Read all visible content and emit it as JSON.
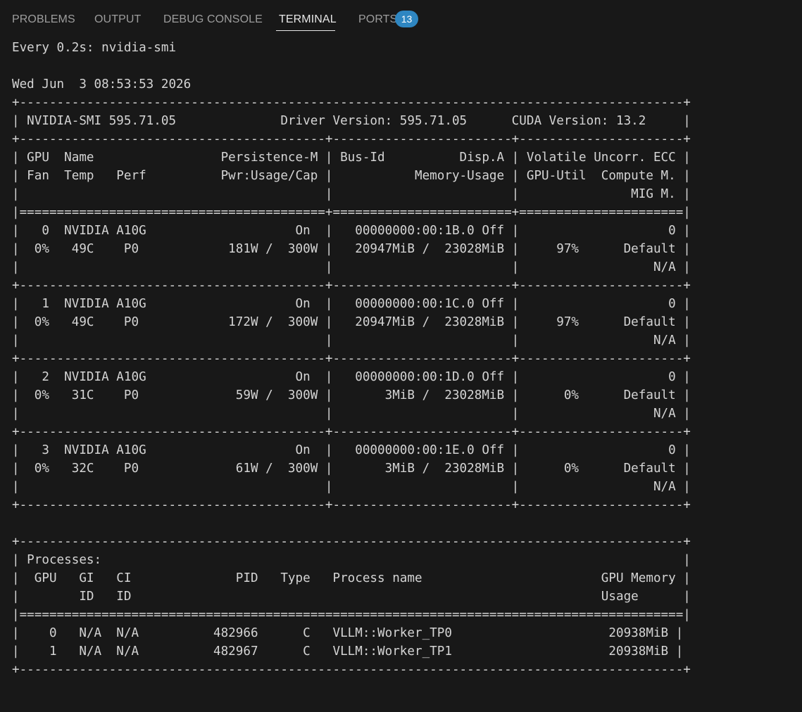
{
  "panel": {
    "tabs": [
      {
        "label": "PROBLEMS"
      },
      {
        "label": "OUTPUT"
      },
      {
        "label": "DEBUG CONSOLE"
      },
      {
        "label": "TERMINAL"
      },
      {
        "label": "PORTS"
      }
    ],
    "active_tab": "TERMINAL",
    "ports_badge": "13"
  },
  "terminal": {
    "lines": [
      "Every 0.2s: nvidia-smi",
      "",
      "Wed Jun  3 08:53:53 2026",
      "+-----------------------------------------------------------------------------------------+",
      "| NVIDIA-SMI 595.71.05              Driver Version: 595.71.05      CUDA Version: 13.2     |",
      "+-----------------------------------------+------------------------+----------------------+",
      "| GPU  Name                 Persistence-M | Bus-Id          Disp.A | Volatile Uncorr. ECC |",
      "| Fan  Temp   Perf          Pwr:Usage/Cap |           Memory-Usage | GPU-Util  Compute M. |",
      "|                                         |                        |               MIG M. |",
      "|=========================================+========================+======================|",
      "|   0  NVIDIA A10G                    On  |   00000000:00:1B.0 Off |                    0 |",
      "|  0%   49C    P0            181W /  300W |   20947MiB /  23028MiB |     97%      Default |",
      "|                                         |                        |                  N/A |",
      "+-----------------------------------------+------------------------+----------------------+",
      "|   1  NVIDIA A10G                    On  |   00000000:00:1C.0 Off |                    0 |",
      "|  0%   49C    P0            172W /  300W |   20947MiB /  23028MiB |     97%      Default |",
      "|                                         |                        |                  N/A |",
      "+-----------------------------------------+------------------------+----------------------+",
      "|   2  NVIDIA A10G                    On  |   00000000:00:1D.0 Off |                    0 |",
      "|  0%   31C    P0             59W /  300W |       3MiB /  23028MiB |      0%      Default |",
      "|                                         |                        |                  N/A |",
      "+-----------------------------------------+------------------------+----------------------+",
      "|   3  NVIDIA A10G                    On  |   00000000:00:1E.0 Off |                    0 |",
      "|  0%   32C    P0             61W /  300W |       3MiB /  23028MiB |      0%      Default |",
      "|                                         |                        |                  N/A |",
      "+-----------------------------------------+------------------------+----------------------+",
      "",
      "+-----------------------------------------------------------------------------------------+",
      "| Processes:                                                                              |",
      "|  GPU   GI   CI              PID   Type   Process name                        GPU Memory |",
      "|        ID   ID                                                               Usage      |",
      "|=========================================================================================|",
      "|    0   N/A  N/A          482966      C   VLLM::Worker_TP0                     20938MiB |",
      "|    1   N/A  N/A          482967      C   VLLM::Worker_TP1                     20938MiB |",
      "+-----------------------------------------------------------------------------------------+"
    ]
  }
}
